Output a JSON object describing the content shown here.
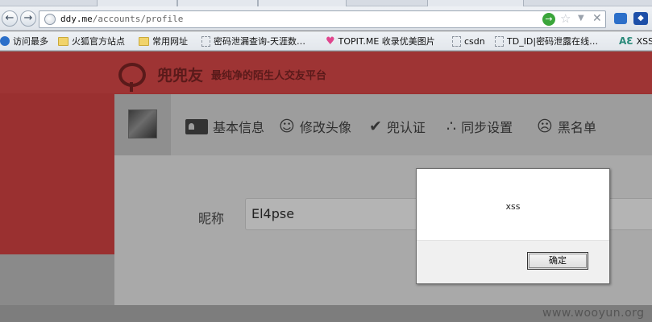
{
  "browser": {
    "url_host": "ddy.me",
    "url_path": "/accounts/profile",
    "nav_back_icon": "arrow-left-icon",
    "nav_forward_icon": "arrow-right-icon"
  },
  "bookmarks": [
    {
      "label": "访问最多",
      "icon": "globe-icon"
    },
    {
      "label": "火狐官方站点",
      "icon": "folder-icon"
    },
    {
      "label": "常用网址",
      "icon": "folder-icon"
    },
    {
      "label": "密码泄漏查询-天涯数…",
      "icon": "page-icon"
    },
    {
      "label": "TOPIT.ME 收录优美图片",
      "icon": "heart-icon"
    },
    {
      "label": "csdn",
      "icon": "page-icon"
    },
    {
      "label": "TD_ID|密码泄露在线…",
      "icon": "page-icon"
    },
    {
      "label": "XSS",
      "icon": "ac-icon"
    }
  ],
  "site": {
    "brand": "兜兜友",
    "slogan": "最纯净的陌生人交友平台"
  },
  "profile_tabs": [
    {
      "label": "基本信息",
      "icon": "id-card-icon"
    },
    {
      "label": "修改头像",
      "icon": "smile-icon"
    },
    {
      "label": "兜认证",
      "icon": "shield-check-icon"
    },
    {
      "label": "同步设置",
      "icon": "share-icon"
    },
    {
      "label": "黑名单",
      "icon": "sad-face-icon"
    }
  ],
  "form": {
    "nickname_label": "昵称",
    "nickname_value": "El4pse"
  },
  "alert": {
    "message": "xss",
    "ok_label": "确定"
  },
  "watermark": "www.wooyun.org",
  "colors": {
    "banner": "#9e3434",
    "brand_dark": "#5a1a1a"
  }
}
